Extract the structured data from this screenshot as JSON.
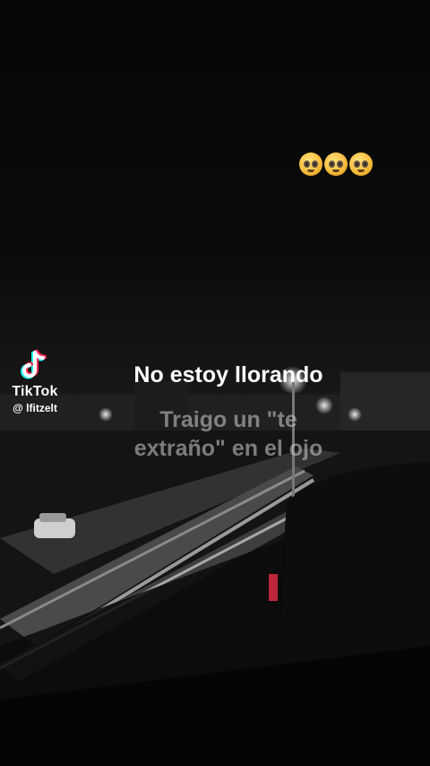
{
  "video": {
    "caption_line1": "No estoy llorando",
    "caption_line2a": "Traigo un \"te",
    "caption_line2b": "extraño\" en el ojo",
    "emoji_count": 3,
    "emoji_name": "pleading-face"
  },
  "watermark": {
    "brand": "TikTok",
    "handle": "@ lfitzelt"
  },
  "colors": {
    "caption": "#ffffff",
    "caption_faded": "#d2d2d2",
    "tiktok_cyan": "#25f4ee",
    "tiktok_red": "#fe2c55"
  }
}
